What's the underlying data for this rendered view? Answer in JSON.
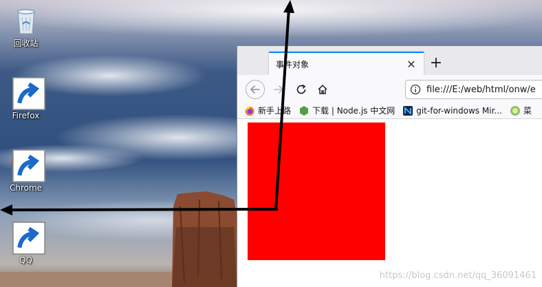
{
  "desktop": {
    "icons": [
      {
        "label": "回收站",
        "icon": "recycle-bin-icon",
        "shortcut": false
      },
      {
        "label": "Firefox",
        "icon": "firefox-icon",
        "shortcut": true
      },
      {
        "label": "Chrome",
        "icon": "chrome-icon",
        "shortcut": true
      },
      {
        "label": "QQ",
        "icon": "qq-penguin-icon",
        "shortcut": true
      }
    ]
  },
  "browser": {
    "tab": {
      "title": "事件对象",
      "close_glyph": "✕"
    },
    "new_tab_glyph": "+",
    "navbar": {
      "url": "file:///E:/web/html/onw/e"
    },
    "bookmarks": [
      {
        "label": "新手上路",
        "icon": "firefox-icon"
      },
      {
        "label": "下载 | Node.js 中文网",
        "icon": "nodejs-icon"
      },
      {
        "label": "git-for-windows Mir...",
        "icon": "git-bash-icon"
      },
      {
        "label": "菜",
        "icon": "cooking-icon"
      }
    ],
    "content": {
      "box_color": "#ff0000"
    },
    "watermark": "https://blog.csdn.net/qq_36091461"
  },
  "colors": {
    "accent": "#0a84ff",
    "arrow": "#000000"
  }
}
